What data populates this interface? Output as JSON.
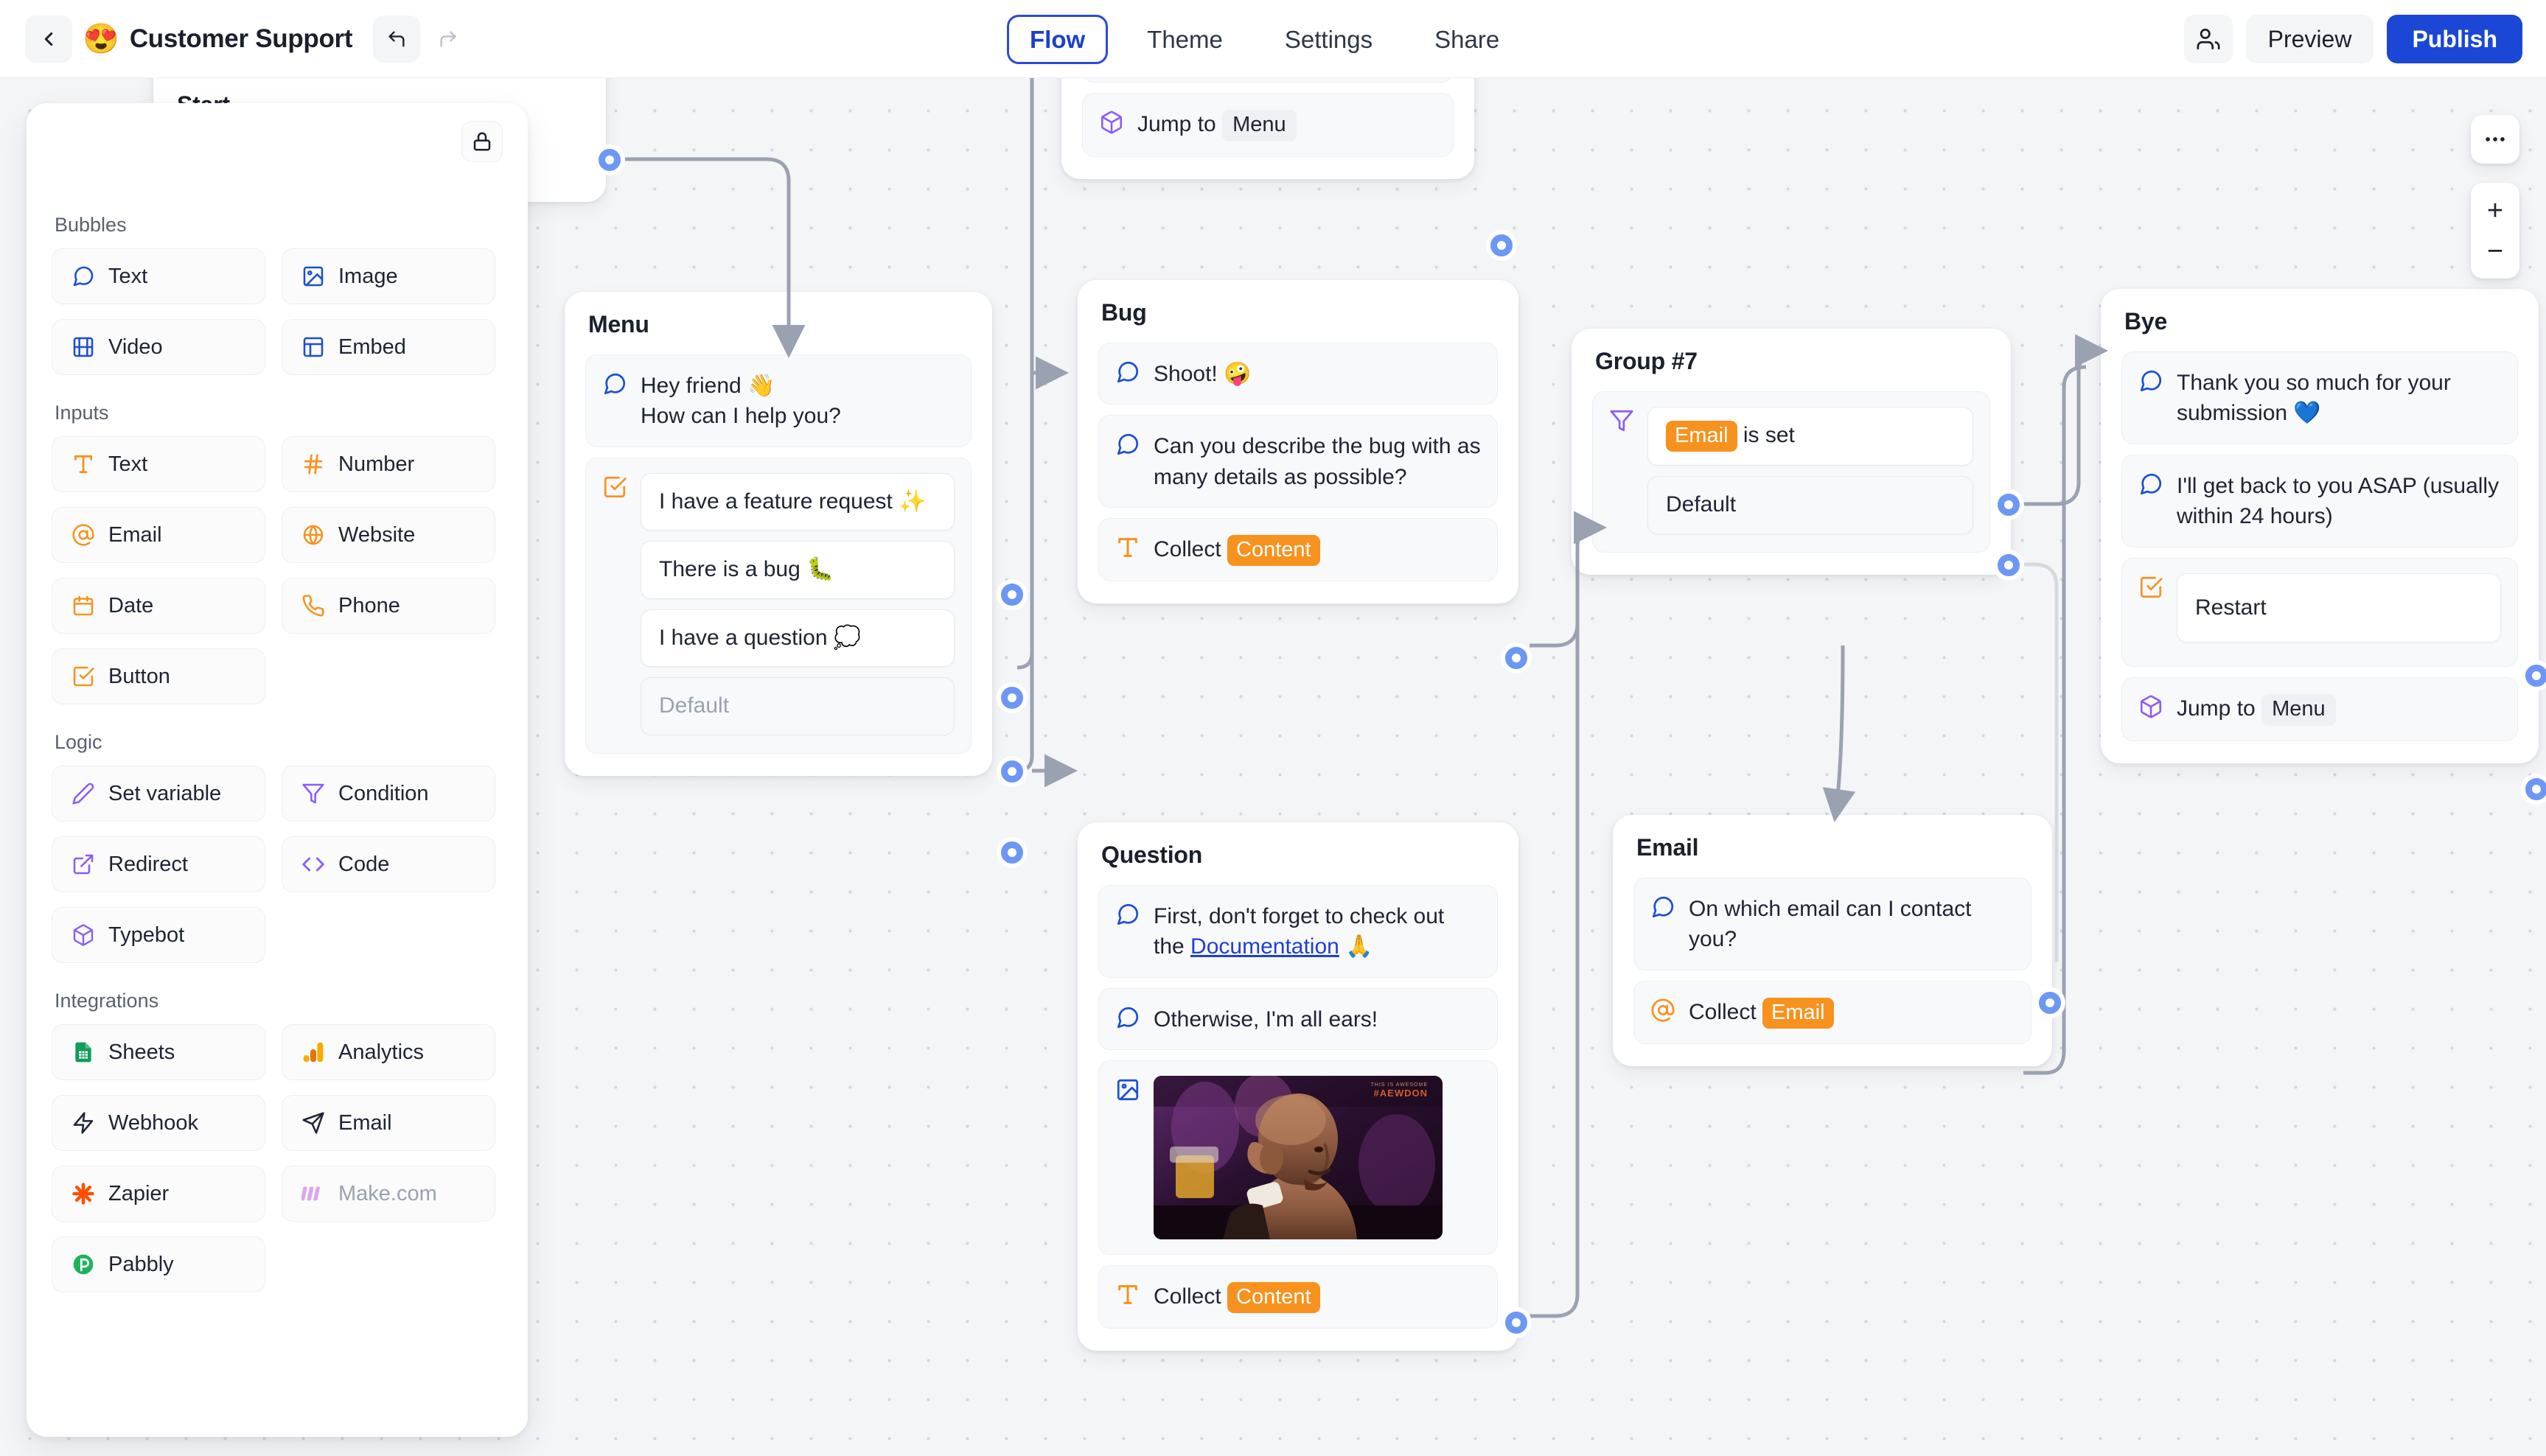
{
  "header": {
    "back_icon": "chevron-left-icon",
    "bot_emoji": "😍",
    "bot_name": "Customer Support",
    "undo_icon": "undo-icon",
    "redo_icon": "redo-icon",
    "tabs": [
      {
        "label": "Flow",
        "active": true
      },
      {
        "label": "Theme",
        "active": false
      },
      {
        "label": "Settings",
        "active": false
      },
      {
        "label": "Share",
        "active": false
      }
    ],
    "members_icon": "users-icon",
    "preview_label": "Preview",
    "publish_label": "Publish",
    "accent": "#1a47d6"
  },
  "sidebar": {
    "lock_icon": "lock-icon",
    "sections": [
      {
        "title": "Bubbles",
        "color": "#1b4dd8",
        "items": [
          {
            "label": "Text",
            "icon": "message-square-icon"
          },
          {
            "label": "Image",
            "icon": "image-icon"
          },
          {
            "label": "Video",
            "icon": "film-icon"
          },
          {
            "label": "Embed",
            "icon": "layout-icon"
          }
        ]
      },
      {
        "title": "Inputs",
        "color": "#f7921e",
        "items": [
          {
            "label": "Text",
            "icon": "type-icon"
          },
          {
            "label": "Number",
            "icon": "hash-icon"
          },
          {
            "label": "Email",
            "icon": "at-sign-icon"
          },
          {
            "label": "Website",
            "icon": "globe-icon"
          },
          {
            "label": "Date",
            "icon": "calendar-icon"
          },
          {
            "label": "Phone",
            "icon": "phone-icon"
          },
          {
            "label": "Button",
            "icon": "check-square-icon"
          }
        ]
      },
      {
        "title": "Logic",
        "color": "#8b5cf6",
        "items": [
          {
            "label": "Set variable",
            "icon": "pencil-icon"
          },
          {
            "label": "Condition",
            "icon": "filter-icon"
          },
          {
            "label": "Redirect",
            "icon": "external-link-icon"
          },
          {
            "label": "Code",
            "icon": "code-icon"
          },
          {
            "label": "Typebot",
            "icon": "cube-icon"
          }
        ]
      },
      {
        "title": "Integrations",
        "color": "#1e2433",
        "items": [
          {
            "label": "Sheets",
            "icon": "google-sheets-icon",
            "disabled": false
          },
          {
            "label": "Analytics",
            "icon": "google-analytics-icon",
            "disabled": false
          },
          {
            "label": "Webhook",
            "icon": "zap-icon",
            "disabled": false
          },
          {
            "label": "Email",
            "icon": "send-icon",
            "disabled": false
          },
          {
            "label": "Zapier",
            "icon": "zapier-icon",
            "disabled": false
          },
          {
            "label": "Make.com",
            "icon": "make-icon",
            "disabled": true
          },
          {
            "label": "Pabbly",
            "icon": "pabbly-icon",
            "disabled": false
          }
        ]
      }
    ]
  },
  "canvas": {
    "controls": {
      "more_icon": "ellipsis-icon",
      "zoom_in_label": "+",
      "zoom_out_label": "−"
    },
    "nodes": {
      "start": {
        "title": "Start"
      },
      "top_jump": {
        "jump_label": "Jump to",
        "jump_target": "Menu",
        "icon": "cube-icon"
      },
      "menu": {
        "title": "Menu",
        "bubble": "Hey friend 👋\nHow can I help you?",
        "bubble_line1": "Hey friend 👋",
        "bubble_line2": "How can I help you?",
        "choices": [
          "I have a feature request ✨",
          "There is a bug 🐛",
          "I have a question 💭"
        ],
        "default_label": "Default"
      },
      "bug": {
        "title": "Bug",
        "bubble1": "Shoot! 🤪",
        "bubble2": "Can you describe the bug with as many details as possible?",
        "collect_label": "Collect",
        "collect_var": "Content"
      },
      "question": {
        "title": "Question",
        "bubble1_pre": "First, don't forget to check out the ",
        "bubble1_link": "Documentation",
        "bubble1_post": " 🙏",
        "bubble2": "Otherwise, I'm all ears!",
        "image_alt": "wrestler-listening-gif",
        "collect_label": "Collect",
        "collect_var": "Content"
      },
      "group7": {
        "title": "Group #7",
        "condition_var": "Email",
        "condition_text": "is set",
        "default_label": "Default"
      },
      "email": {
        "title": "Email",
        "bubble1": "On which email can I contact you?",
        "collect_label": "Collect",
        "collect_var": "Email"
      },
      "bye": {
        "title": "Bye",
        "bubble1": "Thank you so much for your submission 💙",
        "bubble2": "I'll get back to you ASAP (usually within 24 hours)",
        "choice1": "Restart",
        "jump_label": "Jump to",
        "jump_target": "Menu"
      }
    }
  },
  "colors": {
    "bubble_blue": "#1b4dd8",
    "input_orange": "#f7921e",
    "logic_purple": "#8b5cf6",
    "accent_blue": "#1a47d6",
    "handle_blue": "#6d97f5",
    "canvas_bg": "#f4f5f7"
  }
}
